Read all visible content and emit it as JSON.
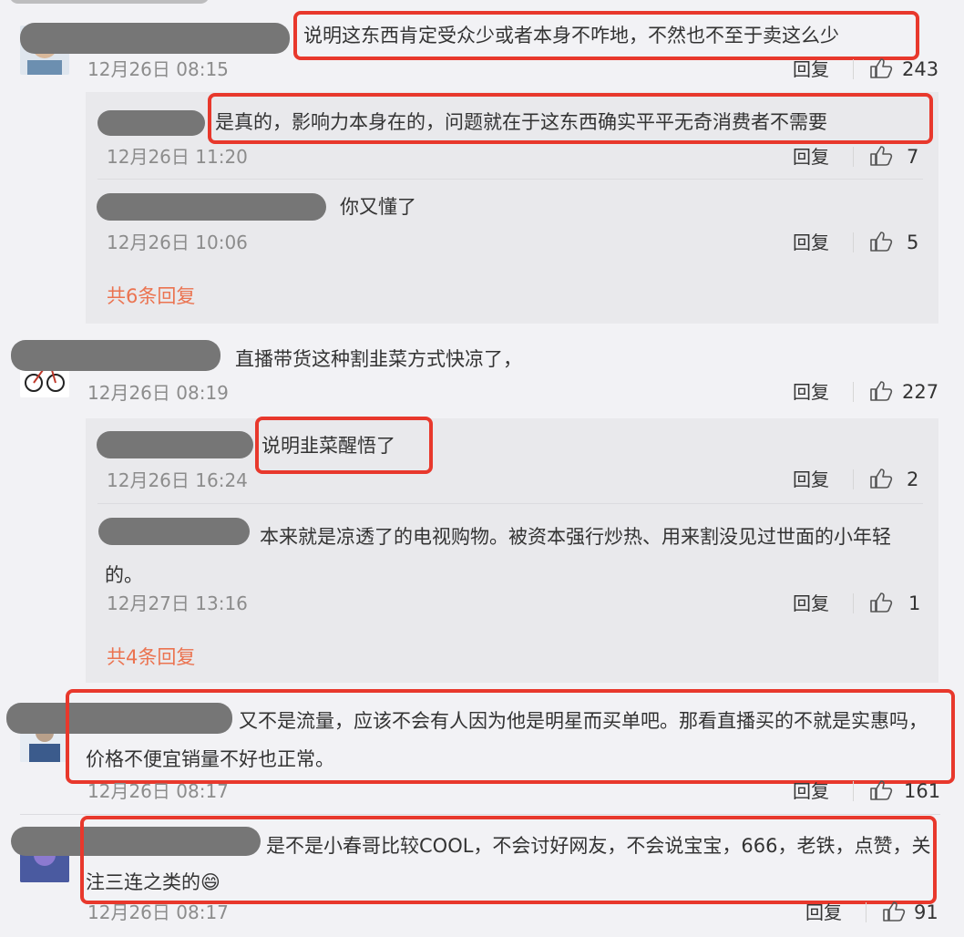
{
  "actions": {
    "reply_label": "回复"
  },
  "comments": [
    {
      "text": "说明这东西肯定受众少或者本身不咋地，不然也不至于卖这么少",
      "date": "12月26日 08:15",
      "likes": "243",
      "replies": [
        {
          "text": "是真的，影响力本身在的，问题就在于这东西确实平平无奇消费者不需要",
          "date": "12月26日 11:20",
          "likes": "7"
        },
        {
          "text": "你又懂了",
          "date": "12月26日 10:06",
          "likes": "5"
        }
      ],
      "more_replies": "共6条回复"
    },
    {
      "text": "直播带货这种割韭菜方式快凉了，",
      "date": "12月26日 08:19",
      "likes": "227",
      "replies": [
        {
          "text": "说明韭菜醒悟了",
          "date": "12月26日 16:24",
          "likes": "2"
        },
        {
          "text": "本来就是凉透了的电视购物。被资本强行炒热、用来割没见过世面的小年轻的。",
          "date": "12月27日 13:16",
          "likes": "1"
        }
      ],
      "more_replies": "共4条回复"
    },
    {
      "text": "又不是流量，应该不会有人因为他是明星而买单吧。那看直播买的不就是实惠吗，价格不便宜销量不好也正常。",
      "date": "12月26日 08:17",
      "likes": "161"
    },
    {
      "text": "是不是小春哥比较COOL，不会讨好网友，不会说宝宝，666，老铁，点赞，关注三连之类的",
      "emoji": "😄",
      "date": "12月26日 08:17",
      "likes": "91"
    }
  ],
  "icons": {
    "like": "thumbs-up-icon"
  },
  "colors": {
    "highlight_box": "#e8382c",
    "more_link": "#eb7350",
    "background": "#f2f2f5",
    "subpanel": "#e9e9ec"
  }
}
